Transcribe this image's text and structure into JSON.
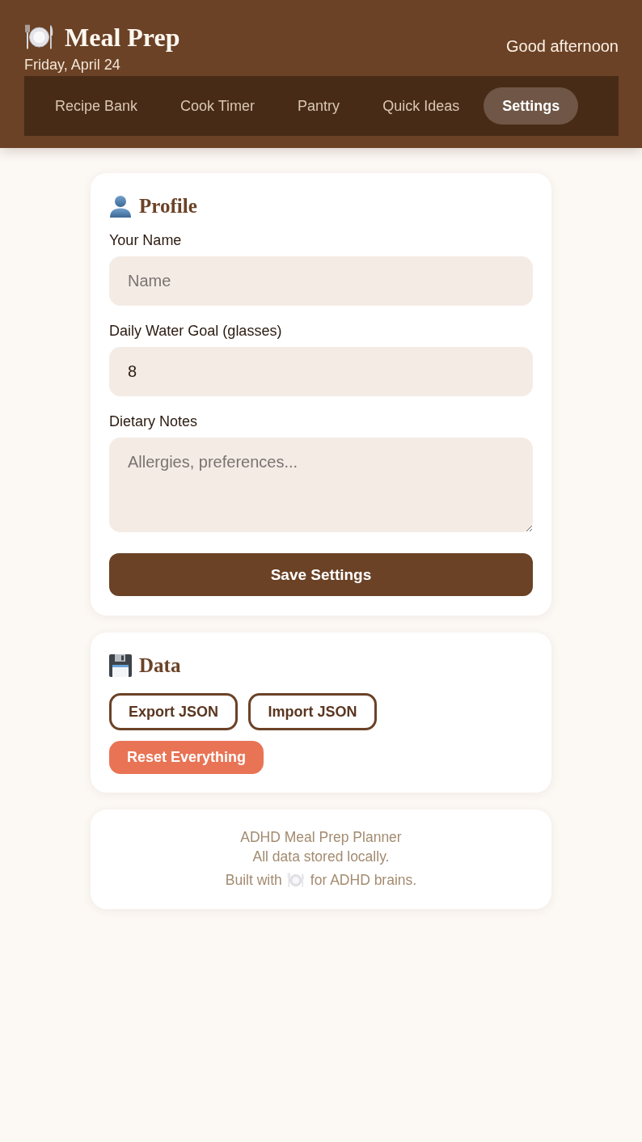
{
  "header": {
    "title": "Meal Prep",
    "date": "Friday, April 24",
    "greeting": "Good afternoon"
  },
  "tabs": [
    {
      "label": "Recipe Bank",
      "selected": false
    },
    {
      "label": "Cook Timer",
      "selected": false
    },
    {
      "label": "Pantry",
      "selected": false
    },
    {
      "label": "Quick Ideas",
      "selected": false
    },
    {
      "label": "Settings",
      "selected": true
    }
  ],
  "profile": {
    "title": "Profile",
    "fields": [
      {
        "kind": "input",
        "label": "Your Name",
        "placeholder": "Name"
      },
      {
        "kind": "input",
        "label": "Daily Water Goal (glasses)",
        "value": "8"
      },
      {
        "kind": "textarea",
        "label": "Dietary Notes",
        "placeholder": "Allergies, preferences..."
      }
    ],
    "save_button": "Save Settings"
  },
  "data": {
    "title": "Data",
    "buttons": [
      {
        "kind": "outline",
        "label": "Export JSON"
      },
      {
        "kind": "outline",
        "label": "Import JSON"
      },
      {
        "kind": "danger",
        "label": "Reset Everything"
      }
    ]
  },
  "footer": {
    "lines": [
      "ADHD Meal Prep Planner",
      "All data stored locally."
    ],
    "credit": {
      "before": "Built with",
      "after": "for ADHD brains."
    }
  }
}
